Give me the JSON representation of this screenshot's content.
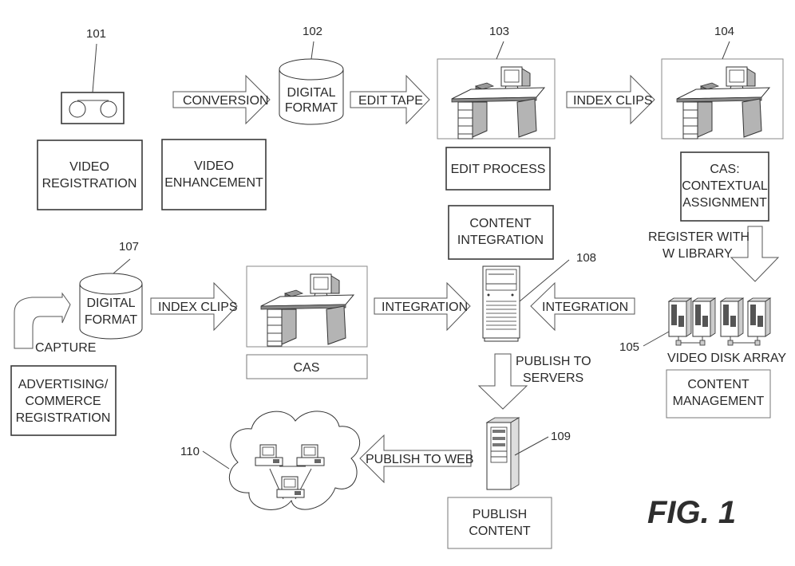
{
  "figure": {
    "title": "FIG. 1"
  },
  "refs": {
    "r101": "101",
    "r102": "102",
    "r103": "103",
    "r104": "104",
    "r105": "105",
    "r107": "107",
    "r108": "108",
    "r109": "109",
    "r110": "110"
  },
  "boxes": {
    "video_registration": [
      "VIDEO",
      "REGISTRATION"
    ],
    "video_enhancement": [
      "VIDEO",
      "ENHANCEMENT"
    ],
    "edit_process": [
      "EDIT PROCESS"
    ],
    "cas_contextual": [
      "CAS:",
      "CONTEXTUAL",
      "ASSIGNMENT"
    ],
    "content_integration": [
      "CONTENT",
      "INTEGRATION"
    ],
    "cas": [
      "CAS"
    ],
    "advertising": [
      "ADVERTISING/",
      "COMMERCE",
      "REGISTRATION"
    ],
    "content_management": [
      "CONTENT",
      "MANAGEMENT"
    ],
    "publish_content": [
      "PUBLISH",
      "CONTENT"
    ]
  },
  "cylinders": {
    "digital_format_top": [
      "DIGITAL",
      "FORMAT"
    ],
    "digital_format_bottom": [
      "DIGITAL",
      "FORMAT"
    ]
  },
  "arrows": {
    "conversion": "CONVERSION",
    "edit_tape": "EDIT TAPE",
    "index_clips_top": "INDEX CLIPS",
    "index_clips_bottom": "INDEX CLIPS",
    "integration_left": "INTEGRATION",
    "integration_right": "INTEGRATION",
    "capture": "CAPTURE",
    "register": [
      "REGISTER WITH",
      "W LIBRARY"
    ],
    "publish_servers": [
      "PUBLISH TO",
      "SERVERS"
    ],
    "publish_web": "PUBLISH TO WEB"
  },
  "labels": {
    "video_disk_array": "VIDEO DISK ARRAY"
  },
  "icons": {
    "tape": "video-tape-icon",
    "workstation": "desk-workstation-icon",
    "server": "tower-server-icon",
    "disk_array": "disk-array-icon",
    "cloud": "network-cloud-icon"
  }
}
